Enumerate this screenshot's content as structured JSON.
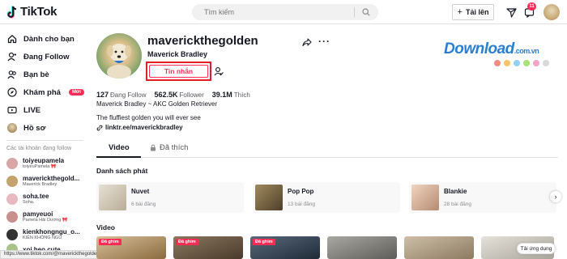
{
  "header": {
    "logo": "TikTok",
    "search_placeholder": "Tìm kiếm",
    "upload_label": "Tải lên",
    "inbox_count": "11"
  },
  "sidebar": {
    "nav": [
      {
        "label": "Dành cho bạn",
        "icon": "home-icon"
      },
      {
        "label": "Đang Follow",
        "icon": "following-icon"
      },
      {
        "label": "Bạn bè",
        "icon": "friends-icon"
      },
      {
        "label": "Khám phá",
        "icon": "compass-icon",
        "badge": "Mới"
      },
      {
        "label": "LIVE",
        "icon": "live-icon"
      },
      {
        "label": "Hồ sơ",
        "icon": "profile-avatar-icon"
      }
    ],
    "following_header": "Các tài khoản đang follow",
    "following": [
      {
        "name": "toiyeupamela",
        "sub": "toiyeuPamela 🎀",
        "color": "#d9a6a6"
      },
      {
        "name": "maverickthegold...",
        "sub": "Maverick Bradley",
        "color": "#c4a36c"
      },
      {
        "name": "soha.tee",
        "sub": "Soha.",
        "color": "#e8b9c0"
      },
      {
        "name": "pamyeuoi",
        "sub": "Pamela Hải Dương 🎀",
        "color": "#c98e8e"
      },
      {
        "name": "kienkhongngu_o...",
        "sub": "KIÊN KHÔNG NGỦ",
        "color": "#333333"
      },
      {
        "name": "xoi.heo.cute",
        "sub": "",
        "color": "#a8c48a"
      }
    ]
  },
  "status_url": "https://www.tiktok.com/@maverickthegolden",
  "profile": {
    "username": "maverickthegolden",
    "display_name": "Maverick Bradley",
    "message_label": "Tin nhắn",
    "stats": [
      {
        "num": "127",
        "label": "Đang Follow"
      },
      {
        "num": "562.5K",
        "label": "Follower"
      },
      {
        "num": "39.1M",
        "label": "Thích"
      }
    ],
    "bio_line1": "Maverick Bradley ~ AKC Golden Retriever",
    "bio_line2": "The fluffiest golden you will ever see",
    "link": "linktr.ee/maverickbradley"
  },
  "watermark": {
    "text": "Download",
    "suffix": ".com.vn",
    "dot_colors": [
      "#f28b82",
      "#f7c36b",
      "#8fd3f0",
      "#a8e07a",
      "#f5a3c7",
      "#d9d9d9"
    ]
  },
  "tabs": {
    "video": "Video",
    "liked": "Đã thích"
  },
  "playlists_title": "Danh sách phát",
  "playlists": [
    {
      "title": "Nuvet",
      "count": "6 bài đăng",
      "color": "#cfc7b8"
    },
    {
      "title": "Pop Pop",
      "count": "13 bài đăng",
      "color": "#7a6a4a"
    },
    {
      "title": "Blankie",
      "count": "28 bài đăng",
      "color": "#d9b8a0"
    }
  ],
  "video_title": "Video",
  "videos": [
    {
      "pin": "Đã ghim",
      "color": "#a88a5e"
    },
    {
      "pin": "Đã ghim",
      "color": "#6b5a48"
    },
    {
      "pin": "Đã ghim",
      "color": "#3a4a5a"
    },
    {
      "pin": "",
      "color": "#8c8a86"
    },
    {
      "pin": "",
      "color": "#b5a58f"
    },
    {
      "pin": "",
      "color": "#d0ccc4"
    }
  ],
  "help_label": "Tải ứng dụng"
}
